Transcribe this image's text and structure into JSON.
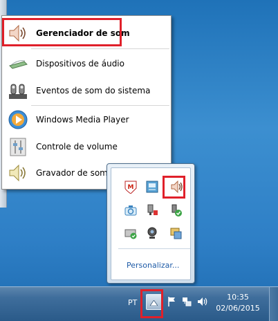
{
  "context_menu": {
    "items": [
      {
        "label": "Gerenciador de som",
        "icon": "speaker-icon",
        "bold": true
      },
      {
        "label": "Dispositivos de áudio",
        "icon": "audio-devices-icon"
      },
      {
        "label": "Eventos de som do sistema",
        "icon": "sound-events-icon"
      },
      {
        "label": "Windows Media Player",
        "icon": "media-player-icon"
      },
      {
        "label": "Controle de volume",
        "icon": "volume-control-icon"
      },
      {
        "label": "Gravador de som",
        "icon": "sound-recorder-icon"
      }
    ]
  },
  "tray_popup": {
    "icons": [
      "mcafee-icon",
      "network-manager-icon",
      "speaker-icon",
      "camera-icon",
      "usb-safe-remove-icon",
      "power-plug-icon",
      "network-check-icon",
      "webcam-icon",
      "devices-icon"
    ],
    "customize_label": "Personalizar..."
  },
  "taskbar": {
    "language": "PT",
    "time": "10:35",
    "date": "02/06/2015"
  },
  "colors": {
    "highlight": "#e0202a",
    "link": "#1d5aa6"
  }
}
